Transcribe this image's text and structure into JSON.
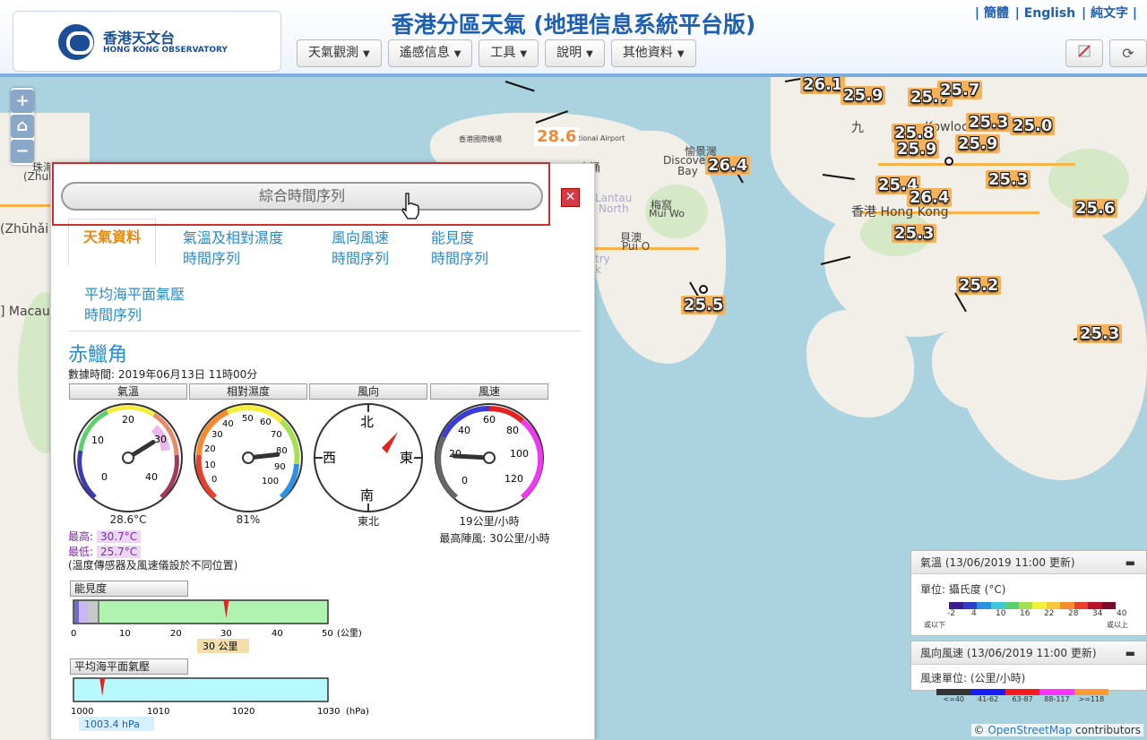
{
  "header": {
    "title": "香港分區天氣 (地理信息系統平台版)",
    "logo_zh": "香港天文台",
    "logo_en": "HONG KONG OBSERVATORY",
    "lang": [
      "| 簡體",
      "| English",
      "| 純文字 |"
    ],
    "nav": [
      {
        "label": "天氣觀測"
      },
      {
        "label": "遙感信息"
      },
      {
        "label": "工具"
      },
      {
        "label": "說明"
      },
      {
        "label": "其他資料"
      }
    ],
    "tools": [
      {
        "icon": "no-layer-icon"
      },
      {
        "icon": "refresh-icon"
      }
    ]
  },
  "map": {
    "labels": [
      "珠海",
      "(Zhuhai)",
      "(Zhūhǎi",
      "] Macau",
      "香港國際機場",
      "ational Airport",
      "東涌",
      "愉景灣",
      "Discovery",
      "Bay",
      "梅窩",
      "Mui Wo",
      "Lantau",
      "North",
      "貝澳",
      "Pui O",
      "九",
      "Kowloon",
      "香港 Hong Kong",
      "try",
      "k"
    ],
    "temps": [
      "26.1",
      "25.9",
      "25.7",
      "25.7",
      "25.8",
      "25.3",
      "25.0",
      "25.9",
      "25.9",
      "26.4",
      "25.4",
      "26.4",
      "25.3",
      "25.6",
      "25.3",
      "25.2",
      "25.5",
      "25.3",
      "28.6"
    ]
  },
  "panel": {
    "series_button": "綜合時間序列",
    "tabs": [
      "天氣資料",
      "氣溫及相對濕度",
      "時間序列",
      "風向風速",
      "時間序列",
      "能見度",
      "時間序列",
      "平均海平面氣壓",
      "時間序列"
    ],
    "station": "赤鱲角",
    "obs_time": "數據時間: 2019年06月13日 11時00分",
    "dials": [
      {
        "head": "氣溫",
        "value": "28.6°C",
        "ticks": [
          "0",
          "10",
          "20",
          "30",
          "40"
        ]
      },
      {
        "head": "相對濕度",
        "value": "81%",
        "ticks": [
          "0",
          "10",
          "20",
          "30",
          "40",
          "50",
          "60",
          "70",
          "80",
          "90",
          "100"
        ]
      },
      {
        "head": "風向",
        "value": "東北",
        "ticks": [
          "北",
          "東",
          "南",
          "西"
        ]
      },
      {
        "head": "風速",
        "value": "19公里/小時",
        "gust": "最高陣風: 30公里/小時",
        "ticks": [
          "0",
          "20",
          "40",
          "60",
          "80",
          "100",
          "120"
        ]
      }
    ],
    "max_label": "最高:",
    "max_value": "30.7°C",
    "min_label": "最低:",
    "min_value": "25.7°C",
    "note": "(溫度傳感器及風速儀設於不同位置)",
    "visibility": {
      "head": "能見度",
      "ticks": [
        "0",
        "10",
        "20",
        "30",
        "40",
        "50"
      ],
      "unit": "(公里)",
      "value": "30 公里",
      "value_num": 30,
      "max": 50
    },
    "pressure": {
      "head": "平均海平面氣壓",
      "ticks": [
        "1000",
        "1010",
        "1020",
        "1030"
      ],
      "unit": "(hPa)",
      "value": "1003.4 hPa",
      "value_num": 1003.4,
      "min": 1000,
      "max": 1030
    }
  },
  "legend_temp": {
    "header": "氣溫 (13/06/2019 11:00 更新)",
    "unit": "單位: 攝氏度 (°C)",
    "ticks": [
      "-2",
      "4",
      "10",
      "16",
      "22",
      "28",
      "34",
      "40"
    ],
    "below": "或以下",
    "above": "或以上",
    "colors": [
      "#3b1e8c",
      "#2d3fc6",
      "#2f8fe0",
      "#3fc6d8",
      "#5ccf6f",
      "#a8de4f",
      "#f4ef3f",
      "#f8c63b",
      "#f58a2f",
      "#e8402b",
      "#b8132a",
      "#7a0d2a"
    ]
  },
  "legend_wind": {
    "header": "風向風速 (13/06/2019 11:00 更新)",
    "unit": "風速單位: (公里/小時)",
    "ticks": [
      "<=40",
      "41-62",
      "63-87",
      "88-117",
      ">=118"
    ],
    "colors": [
      "#333333",
      "#1a1aff",
      "#ff1a1a",
      "#ff33ff",
      "#ff9933"
    ]
  },
  "attribution": {
    "prefix": "© ",
    "link": "OpenStreetMap",
    "suffix": " contributors"
  }
}
